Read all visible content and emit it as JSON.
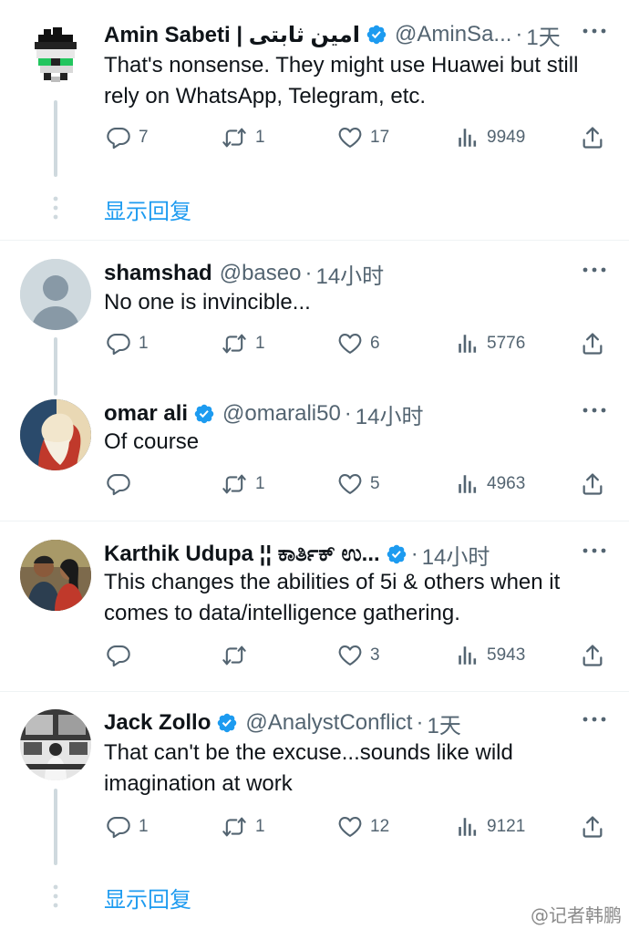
{
  "colors": {
    "accent": "#1d9bf0",
    "text": "#0f1419",
    "muted": "#536471",
    "thread_line": "#cfd9de",
    "divider": "#eff3f4"
  },
  "tweets": [
    {
      "name": "Amin Sabeti | امین ثابتی",
      "verified": true,
      "handle": "@AminSa...",
      "time": "1天",
      "text": "That's nonsense. They might use Huawei but still rely on WhatsApp, Telegram, etc.",
      "replies": "7",
      "retweets": "1",
      "likes": "17",
      "views": "9949",
      "avatar_icon": "pixel-face-avatar"
    },
    {
      "name": "shamshad",
      "verified": false,
      "handle": "@baseo",
      "time": "14小时",
      "text": "No one is invincible...",
      "replies": "1",
      "retweets": "1",
      "likes": "6",
      "views": "5776",
      "avatar_icon": "default-user-avatar"
    },
    {
      "name": "omar ali",
      "verified": true,
      "handle": "@omarali50",
      "time": "14小时",
      "text": "Of course",
      "replies": "",
      "retweets": "1",
      "likes": "5",
      "views": "4963",
      "avatar_icon": "portrait-avatar"
    },
    {
      "name": "Karthik Udupa ¦¦ ಕಾರ್ತಿಕ್ ಉ...",
      "verified": true,
      "handle": "",
      "time": "14小时",
      "text": "This changes the abilities of 5i & others when it comes to data/intelligence gathering.",
      "replies": "",
      "retweets": "",
      "likes": "3",
      "views": "5943",
      "avatar_icon": "couple-photo-avatar"
    },
    {
      "name": "Jack Zollo",
      "verified": true,
      "handle": "@AnalystConflict",
      "time": "1天",
      "text": "That can't be the excuse...sounds like wild imagination at work",
      "replies": "1",
      "retweets": "1",
      "likes": "12",
      "views": "9121",
      "avatar_icon": "monitors-photo-avatar"
    }
  ],
  "show_replies_label": "显示回复",
  "show_replies_label_2": "显示回复",
  "dot": "·",
  "watermark": "@记者韩鹏"
}
